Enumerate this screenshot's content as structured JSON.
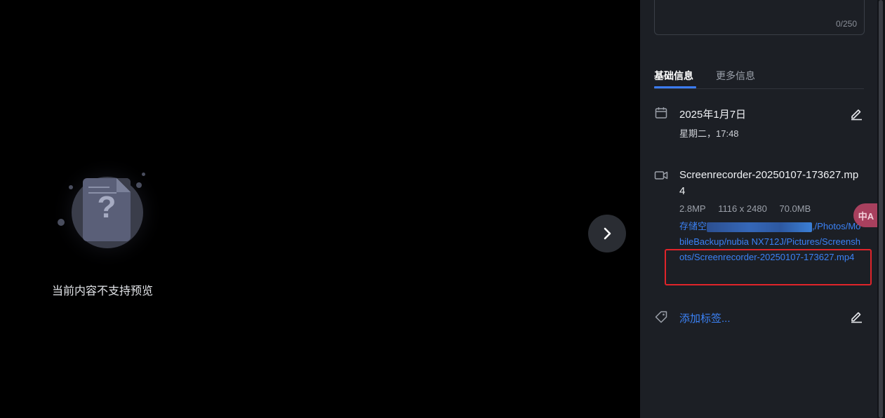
{
  "viewer": {
    "no_preview_text": "当前内容不支持预览",
    "placeholder_symbol": "?"
  },
  "description": {
    "char_count": "0/250"
  },
  "tabs": {
    "basic": "基础信息",
    "more": "更多信息"
  },
  "date": {
    "main": "2025年1月7日",
    "sub": "星期二，17:48"
  },
  "file": {
    "name": "Screenrecorder-20250107-173627.mp4",
    "megapixels": "2.8MP",
    "dimensions": "1116 x 2480",
    "size": "70.0MB",
    "path_prefix": "存储空",
    "path_rest": ",/Photos/MobileBackup/nubia NX712J/Pictures/Screenshots/Screenrecorder-20250107-173627.mp4"
  },
  "tags": {
    "add_label": "添加标签..."
  },
  "translate": {
    "label": "中A"
  },
  "colors": {
    "accent": "#3b82f6",
    "highlight": "#e0242a",
    "panel_bg": "#1c1f25"
  },
  "icons": {
    "date": "calendar-icon",
    "file": "video-camera-icon",
    "tags": "tag-icon",
    "edit": "pencil-icon",
    "next": "chevron-right-icon"
  }
}
